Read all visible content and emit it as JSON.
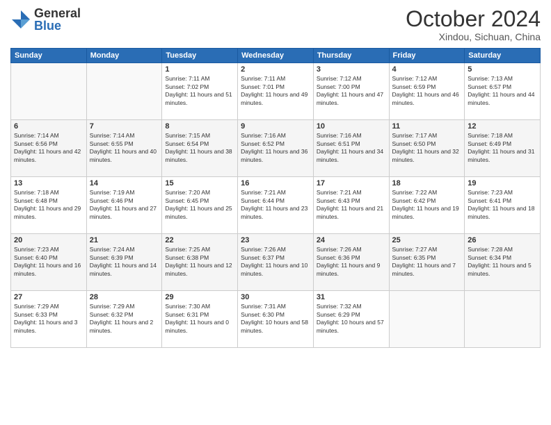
{
  "logo": {
    "general": "General",
    "blue": "Blue"
  },
  "header": {
    "month": "October 2024",
    "location": "Xindou, Sichuan, China"
  },
  "weekdays": [
    "Sunday",
    "Monday",
    "Tuesday",
    "Wednesday",
    "Thursday",
    "Friday",
    "Saturday"
  ],
  "weeks": [
    [
      {
        "day": "",
        "sunrise": "",
        "sunset": "",
        "daylight": ""
      },
      {
        "day": "",
        "sunrise": "",
        "sunset": "",
        "daylight": ""
      },
      {
        "day": "1",
        "sunrise": "Sunrise: 7:11 AM",
        "sunset": "Sunset: 7:02 PM",
        "daylight": "Daylight: 11 hours and 51 minutes."
      },
      {
        "day": "2",
        "sunrise": "Sunrise: 7:11 AM",
        "sunset": "Sunset: 7:01 PM",
        "daylight": "Daylight: 11 hours and 49 minutes."
      },
      {
        "day": "3",
        "sunrise": "Sunrise: 7:12 AM",
        "sunset": "Sunset: 7:00 PM",
        "daylight": "Daylight: 11 hours and 47 minutes."
      },
      {
        "day": "4",
        "sunrise": "Sunrise: 7:12 AM",
        "sunset": "Sunset: 6:59 PM",
        "daylight": "Daylight: 11 hours and 46 minutes."
      },
      {
        "day": "5",
        "sunrise": "Sunrise: 7:13 AM",
        "sunset": "Sunset: 6:57 PM",
        "daylight": "Daylight: 11 hours and 44 minutes."
      }
    ],
    [
      {
        "day": "6",
        "sunrise": "Sunrise: 7:14 AM",
        "sunset": "Sunset: 6:56 PM",
        "daylight": "Daylight: 11 hours and 42 minutes."
      },
      {
        "day": "7",
        "sunrise": "Sunrise: 7:14 AM",
        "sunset": "Sunset: 6:55 PM",
        "daylight": "Daylight: 11 hours and 40 minutes."
      },
      {
        "day": "8",
        "sunrise": "Sunrise: 7:15 AM",
        "sunset": "Sunset: 6:54 PM",
        "daylight": "Daylight: 11 hours and 38 minutes."
      },
      {
        "day": "9",
        "sunrise": "Sunrise: 7:16 AM",
        "sunset": "Sunset: 6:52 PM",
        "daylight": "Daylight: 11 hours and 36 minutes."
      },
      {
        "day": "10",
        "sunrise": "Sunrise: 7:16 AM",
        "sunset": "Sunset: 6:51 PM",
        "daylight": "Daylight: 11 hours and 34 minutes."
      },
      {
        "day": "11",
        "sunrise": "Sunrise: 7:17 AM",
        "sunset": "Sunset: 6:50 PM",
        "daylight": "Daylight: 11 hours and 32 minutes."
      },
      {
        "day": "12",
        "sunrise": "Sunrise: 7:18 AM",
        "sunset": "Sunset: 6:49 PM",
        "daylight": "Daylight: 11 hours and 31 minutes."
      }
    ],
    [
      {
        "day": "13",
        "sunrise": "Sunrise: 7:18 AM",
        "sunset": "Sunset: 6:48 PM",
        "daylight": "Daylight: 11 hours and 29 minutes."
      },
      {
        "day": "14",
        "sunrise": "Sunrise: 7:19 AM",
        "sunset": "Sunset: 6:46 PM",
        "daylight": "Daylight: 11 hours and 27 minutes."
      },
      {
        "day": "15",
        "sunrise": "Sunrise: 7:20 AM",
        "sunset": "Sunset: 6:45 PM",
        "daylight": "Daylight: 11 hours and 25 minutes."
      },
      {
        "day": "16",
        "sunrise": "Sunrise: 7:21 AM",
        "sunset": "Sunset: 6:44 PM",
        "daylight": "Daylight: 11 hours and 23 minutes."
      },
      {
        "day": "17",
        "sunrise": "Sunrise: 7:21 AM",
        "sunset": "Sunset: 6:43 PM",
        "daylight": "Daylight: 11 hours and 21 minutes."
      },
      {
        "day": "18",
        "sunrise": "Sunrise: 7:22 AM",
        "sunset": "Sunset: 6:42 PM",
        "daylight": "Daylight: 11 hours and 19 minutes."
      },
      {
        "day": "19",
        "sunrise": "Sunrise: 7:23 AM",
        "sunset": "Sunset: 6:41 PM",
        "daylight": "Daylight: 11 hours and 18 minutes."
      }
    ],
    [
      {
        "day": "20",
        "sunrise": "Sunrise: 7:23 AM",
        "sunset": "Sunset: 6:40 PM",
        "daylight": "Daylight: 11 hours and 16 minutes."
      },
      {
        "day": "21",
        "sunrise": "Sunrise: 7:24 AM",
        "sunset": "Sunset: 6:39 PM",
        "daylight": "Daylight: 11 hours and 14 minutes."
      },
      {
        "day": "22",
        "sunrise": "Sunrise: 7:25 AM",
        "sunset": "Sunset: 6:38 PM",
        "daylight": "Daylight: 11 hours and 12 minutes."
      },
      {
        "day": "23",
        "sunrise": "Sunrise: 7:26 AM",
        "sunset": "Sunset: 6:37 PM",
        "daylight": "Daylight: 11 hours and 10 minutes."
      },
      {
        "day": "24",
        "sunrise": "Sunrise: 7:26 AM",
        "sunset": "Sunset: 6:36 PM",
        "daylight": "Daylight: 11 hours and 9 minutes."
      },
      {
        "day": "25",
        "sunrise": "Sunrise: 7:27 AM",
        "sunset": "Sunset: 6:35 PM",
        "daylight": "Daylight: 11 hours and 7 minutes."
      },
      {
        "day": "26",
        "sunrise": "Sunrise: 7:28 AM",
        "sunset": "Sunset: 6:34 PM",
        "daylight": "Daylight: 11 hours and 5 minutes."
      }
    ],
    [
      {
        "day": "27",
        "sunrise": "Sunrise: 7:29 AM",
        "sunset": "Sunset: 6:33 PM",
        "daylight": "Daylight: 11 hours and 3 minutes."
      },
      {
        "day": "28",
        "sunrise": "Sunrise: 7:29 AM",
        "sunset": "Sunset: 6:32 PM",
        "daylight": "Daylight: 11 hours and 2 minutes."
      },
      {
        "day": "29",
        "sunrise": "Sunrise: 7:30 AM",
        "sunset": "Sunset: 6:31 PM",
        "daylight": "Daylight: 11 hours and 0 minutes."
      },
      {
        "day": "30",
        "sunrise": "Sunrise: 7:31 AM",
        "sunset": "Sunset: 6:30 PM",
        "daylight": "Daylight: 10 hours and 58 minutes."
      },
      {
        "day": "31",
        "sunrise": "Sunrise: 7:32 AM",
        "sunset": "Sunset: 6:29 PM",
        "daylight": "Daylight: 10 hours and 57 minutes."
      },
      {
        "day": "",
        "sunrise": "",
        "sunset": "",
        "daylight": ""
      },
      {
        "day": "",
        "sunrise": "",
        "sunset": "",
        "daylight": ""
      }
    ]
  ]
}
